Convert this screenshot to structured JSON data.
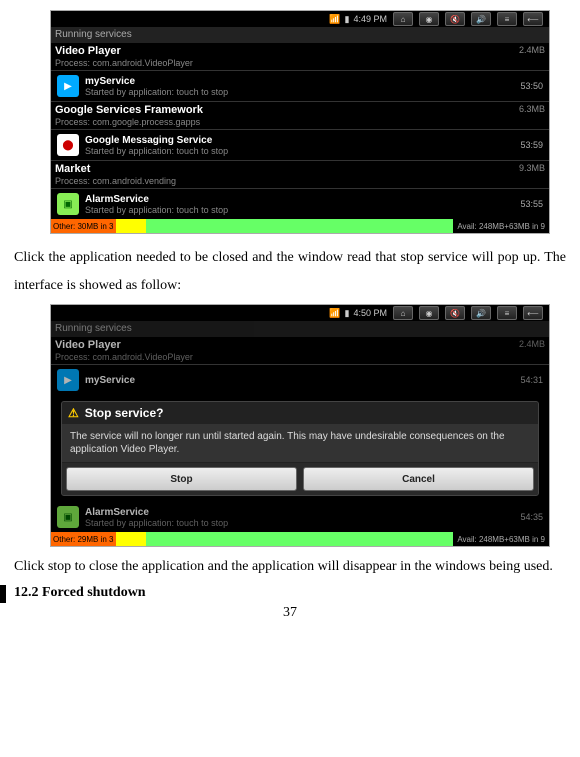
{
  "statusbar1": {
    "time": "4:49 PM",
    "icons": [
      "wifi-icon",
      "battery-icon",
      "camera-icon",
      "vol-down-icon",
      "vol-up-icon",
      "menu-icon",
      "back-icon"
    ]
  },
  "statusbar2": {
    "time": "4:50 PM"
  },
  "title": "Running services",
  "items1": [
    {
      "head": "Video Player",
      "proc": "Process: com.android.VideoPlayer",
      "size": "2.4MB",
      "service": "myService",
      "started": "Started by application: touch to stop",
      "time": "53:50",
      "iconBg": "#0af"
    },
    {
      "head": "Google Services Framework",
      "proc": "Process: com.google.process.gapps",
      "size": "6.3MB",
      "service": "Google Messaging Service",
      "started": "Started by application: touch to stop",
      "time": "53:59",
      "iconBg": "#fff"
    },
    {
      "head": "Market",
      "proc": "Process: com.android.vending",
      "size": "9.3MB",
      "service": "AlarmService",
      "started": "Started by application: touch to stop",
      "time": "53:55",
      "iconBg": "#8e5"
    }
  ],
  "footer1": {
    "left": "Other:",
    "leftval": "30MB in 3",
    "right": "Avail: 248MB+63MB in 9"
  },
  "text1": "Click the application needed to be closed and the window read that stop service will pop up. The interface is showed as follow:",
  "items2": {
    "vp_head": "Video Player",
    "vp_proc": "Process: com.android.VideoPlayer",
    "vp_size": "2.4MB",
    "vp_service": "myService",
    "vp_time": "54:31",
    "alarm_service": "AlarmService",
    "alarm_started": "Started by application: touch to stop",
    "alarm_time": "54:35"
  },
  "dialog": {
    "title": "Stop service?",
    "body": "The service will no longer run until started again. This may have undesirable consequences on the application Video Player.",
    "stop": "Stop",
    "cancel": "Cancel"
  },
  "footer2": {
    "left": "Other:",
    "leftval": "29MB in 3",
    "right": "Avail: 248MB+63MB in 9"
  },
  "text2": "Click stop to close the application and the application will disappear in the windows being used.",
  "heading": "12.2 Forced shutdown",
  "page": "37"
}
